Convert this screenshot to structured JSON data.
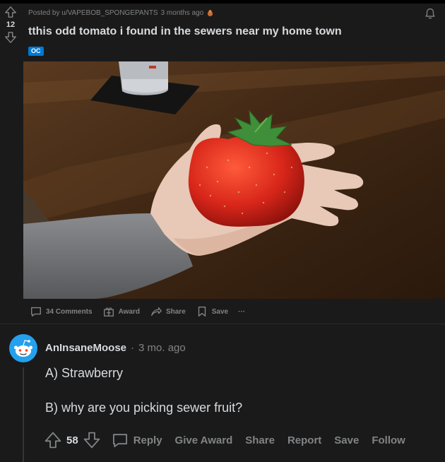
{
  "post": {
    "score": "12",
    "posted_by": "Posted by u/VAPEBOB_SPONGEPANTS",
    "age": "3 months ago",
    "title": "tthis odd tomato i found in the sewers near my home town",
    "flair": "OC",
    "actions": {
      "comments": "34 Comments",
      "award": "Award",
      "share": "Share",
      "save": "Save",
      "more": "···"
    }
  },
  "comment": {
    "author": "AnInsaneMoose",
    "separator": "·",
    "age": "3 mo. ago",
    "line1": "A) Strawberry",
    "line2": "B) why are you picking sewer fruit?",
    "score": "58",
    "actions": {
      "reply": "Reply",
      "give_award": "Give Award",
      "share": "Share",
      "report": "Report",
      "save": "Save",
      "follow": "Follow"
    }
  },
  "colors": {
    "background": "#1a1a1b",
    "text": "#d7dadc",
    "muted": "#818384",
    "flair": "#0079d3"
  },
  "icons": [
    "upvote-icon",
    "downvote-icon",
    "notification-bell-icon",
    "comment-icon",
    "award-icon",
    "share-icon",
    "save-icon",
    "more-icon",
    "snoo-avatar-icon"
  ]
}
